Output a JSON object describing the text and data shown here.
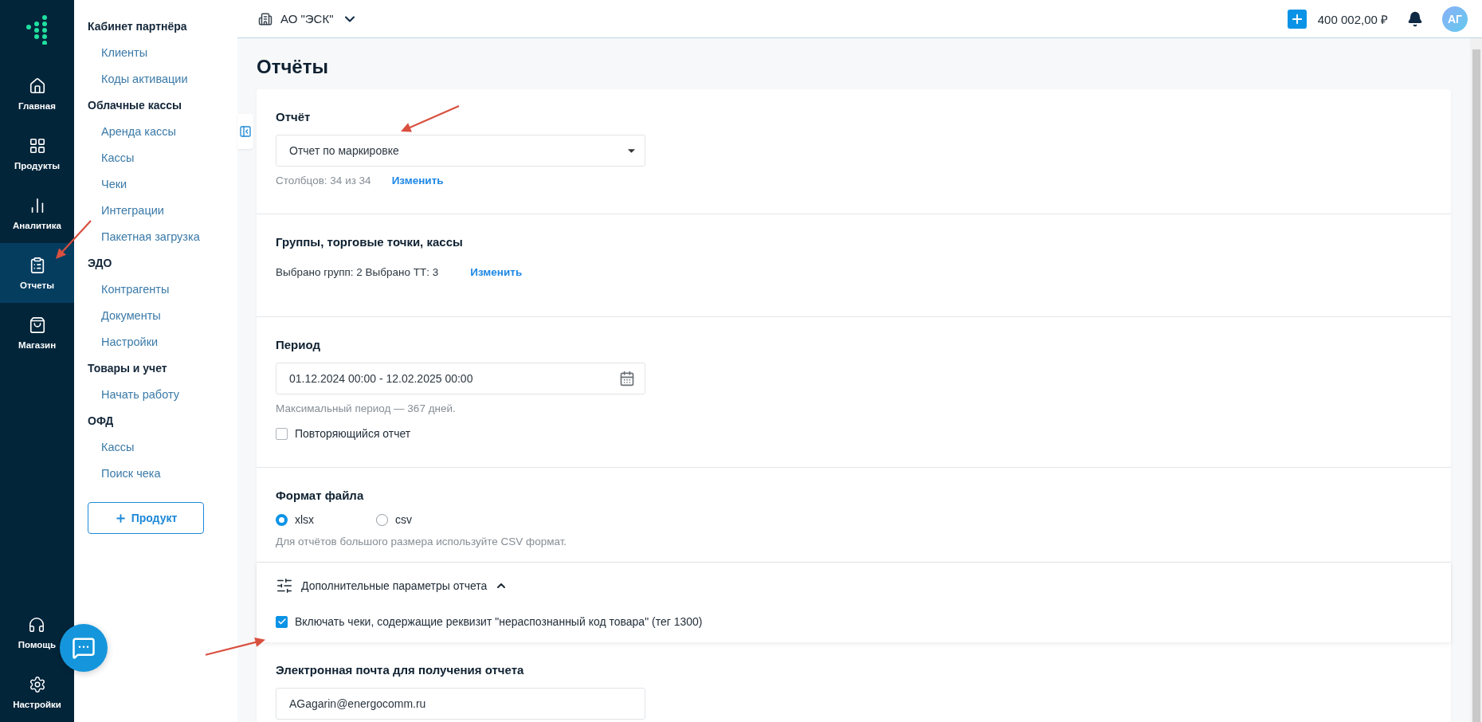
{
  "nav_rail": {
    "items": [
      {
        "label": "Главная",
        "selected": false
      },
      {
        "label": "Продукты",
        "selected": false
      },
      {
        "label": "Аналитика",
        "selected": false
      },
      {
        "label": "Отчеты",
        "selected": true
      },
      {
        "label": "Магазин",
        "selected": false
      }
    ],
    "bottom_items": [
      {
        "label": "Помощь"
      },
      {
        "label": "Настройки"
      }
    ]
  },
  "sidebar": {
    "sections": [
      {
        "heading": "Кабинет партнёра",
        "items": [
          "Клиенты",
          "Коды активации"
        ]
      },
      {
        "heading": "Облачные кассы",
        "items": [
          "Аренда кассы",
          "Кассы",
          "Чеки",
          "Интеграции",
          "Пакетная загрузка"
        ]
      },
      {
        "heading": "ЭДО",
        "items": [
          "Контрагенты",
          "Документы",
          "Настройки"
        ]
      },
      {
        "heading": "Товары и учет",
        "items": [
          "Начать работу"
        ]
      },
      {
        "heading": "ОФД",
        "items": [
          "Кассы",
          "Поиск чека"
        ]
      }
    ],
    "add_button": "Продукт"
  },
  "topbar": {
    "organization": "АО \"ЭСК\"",
    "balance": "400 002,00 ₽",
    "avatar": "АГ"
  },
  "page_title": "Отчёты",
  "report": {
    "heading": "Отчёт",
    "select_value": "Отчет по маркировке",
    "columns_info": "Столбцов: 34 из 34",
    "change_link": "Изменить"
  },
  "groups": {
    "heading": "Группы, торговые точки, кассы",
    "summary": "Выбрано групп: 2 Выбрано ТТ: 3",
    "change_link": "Изменить"
  },
  "period": {
    "heading": "Период",
    "value": "01.12.2024 00:00 - 12.02.2025 00:00",
    "hint": "Максимальный период — 367 дней.",
    "repeat": {
      "label": "Повторяющийся отчет",
      "checked": false
    }
  },
  "file_format": {
    "heading": "Формат файла",
    "options": [
      {
        "label": "xlsx",
        "selected": true
      },
      {
        "label": "csv",
        "selected": false
      }
    ],
    "hint": "Для отчётов большого размера используйте CSV формат."
  },
  "advanced": {
    "label": "Дополнительные параметры отчета",
    "expanded": true,
    "options": [
      {
        "label": "Включать чеки, содержащие реквизит \"нераспознанный код товара\" (тег 1300)",
        "checked": true
      }
    ]
  },
  "email": {
    "heading": "Электронная почта для получения отчета",
    "value": "AGagarin@energocomm.ru"
  }
}
